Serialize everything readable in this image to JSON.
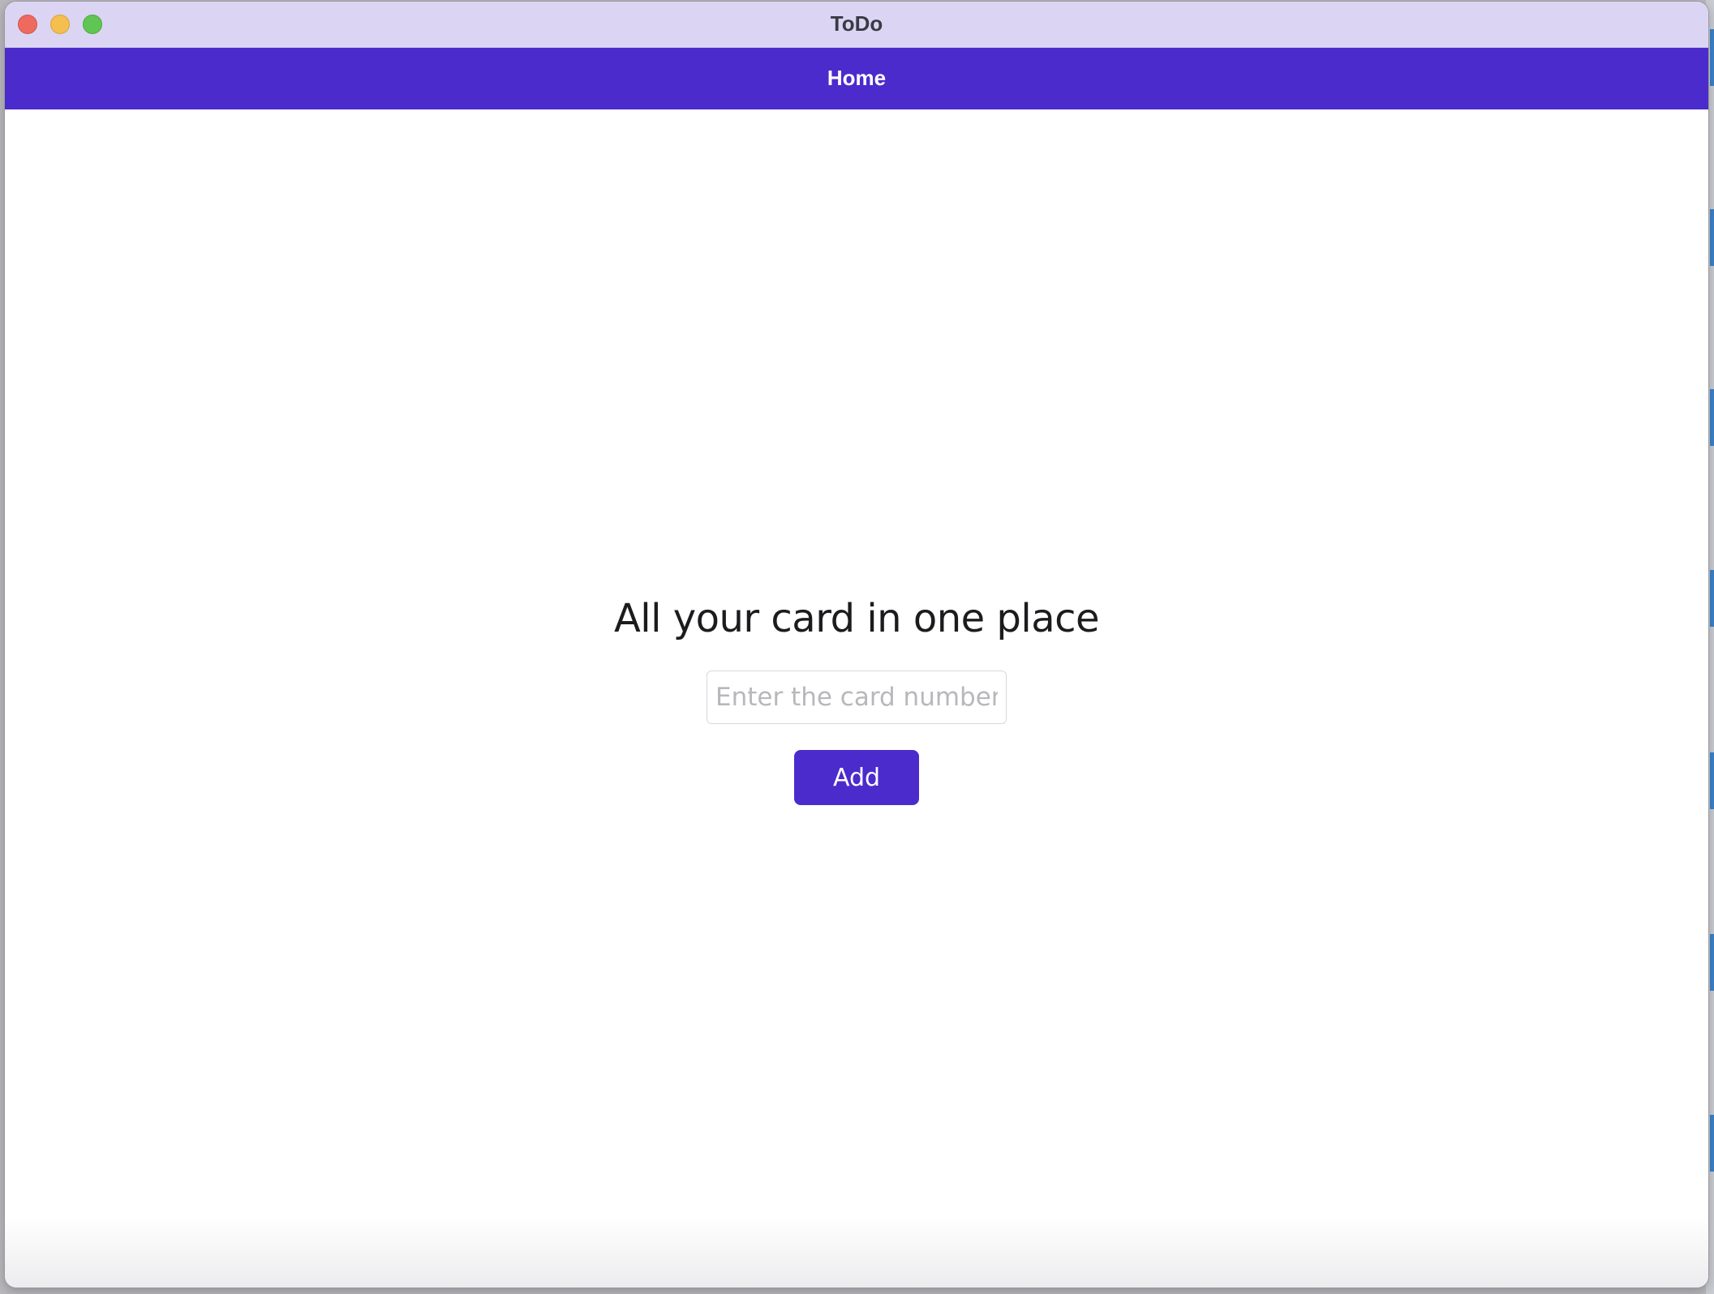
{
  "window": {
    "title": "ToDo"
  },
  "navbar": {
    "title": "Home"
  },
  "main": {
    "heading": "All your card in one place",
    "card_input": {
      "value": "",
      "placeholder": "Enter the card number"
    },
    "add_label": "Add"
  },
  "colors": {
    "accent": "#4c2bcc",
    "titlebar": "#dbd5f3",
    "close": "#ee6a5f",
    "minimize": "#f5bf4f",
    "maximize": "#61c554"
  }
}
